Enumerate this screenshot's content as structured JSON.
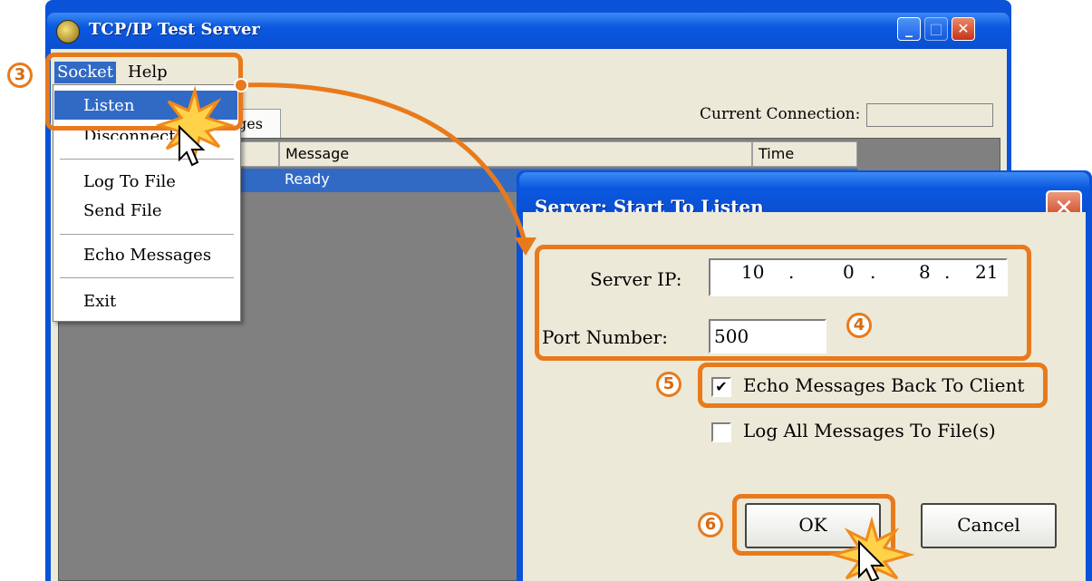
{
  "main_window": {
    "title": "TCP/IP Test Server",
    "menu": {
      "socket": "Socket",
      "help": "Help"
    },
    "current_connection_label": "Current Connection:",
    "tab_label": "ges",
    "grid": {
      "columns": [
        "Message",
        "Time"
      ],
      "rows": [
        {
          "message": "Ready"
        }
      ]
    },
    "close_glyph": "✕"
  },
  "socket_menu": {
    "items": [
      "Listen",
      "Disconnect",
      "Log To File",
      "Send File",
      "Echo Messages",
      "Exit"
    ]
  },
  "dialog": {
    "title": "Server: Start To Listen",
    "close_glyph": "✕",
    "server_ip_label": "Server IP:",
    "ip_octets": [
      "10",
      "0",
      "8",
      "21"
    ],
    "ip_dot": ".",
    "port_label": "Port Number:",
    "port_value": "500",
    "echo_label": "Echo Messages Back To Client",
    "echo_checked_glyph": "✔",
    "log_label": "Log All Messages To File(s)",
    "ok_label": "OK",
    "cancel_label": "Cancel"
  },
  "annotations": {
    "step3": "3",
    "step4": "4",
    "step5": "5",
    "step6": "6"
  },
  "colors": {
    "accent": "#e87a1c",
    "selection": "#316ac5",
    "title_bar": "#0a53d8"
  }
}
